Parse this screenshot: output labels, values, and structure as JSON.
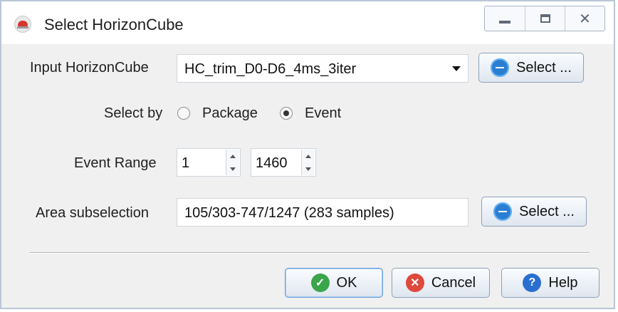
{
  "window": {
    "title": "Select HorizonCube",
    "icons": {
      "app": "app-icon",
      "minimize": "minimize-icon",
      "maximize": "maximize-icon",
      "close": "close-icon"
    }
  },
  "form": {
    "input_label": "Input HorizonCube",
    "input_value": "HC_trim_D0-D6_4ms_3iter",
    "input_select_label": "Select ...",
    "select_by_label": "Select by",
    "radio_package_label": "Package",
    "radio_event_label": "Event",
    "selected_radio": "Event",
    "event_range_label": "Event Range",
    "event_range_start": "1",
    "event_range_end": "1460",
    "area_label": "Area subselection",
    "area_value": "105/303-747/1247 (283 samples)",
    "area_select_label": "Select ..."
  },
  "buttons": {
    "ok": "OK",
    "cancel": "Cancel",
    "help": "Help"
  },
  "colors": {
    "ok_icon": "#3aa54a",
    "cancel_icon": "#e0483c",
    "help_icon": "#2a6fd0",
    "list_icon": "#2a7fd3"
  }
}
